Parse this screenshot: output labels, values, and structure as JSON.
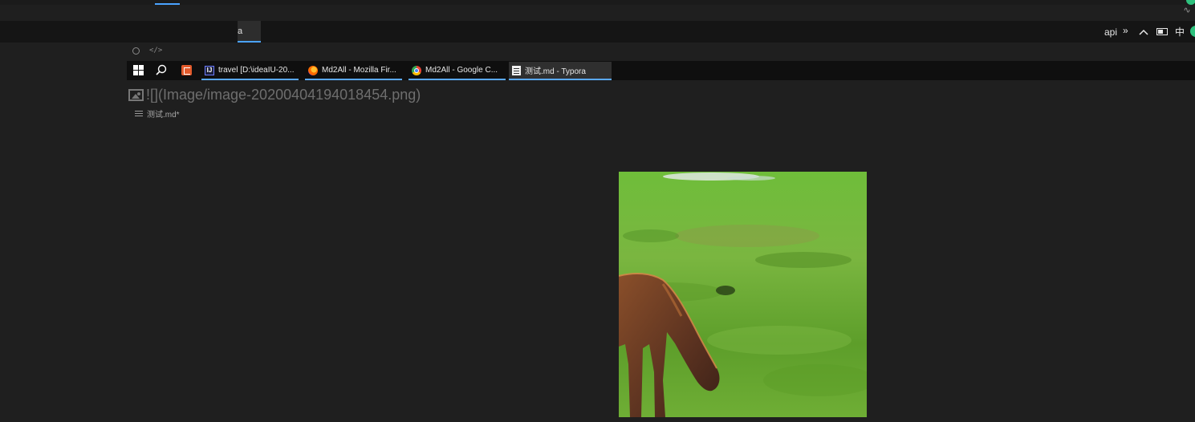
{
  "top_bar": {
    "right_glyph": "∿"
  },
  "tab_bar": {
    "active_tab_label": "a"
  },
  "tray": {
    "api_label": "api",
    "overflow_glyph": "»",
    "show_hidden_glyph": "^",
    "ime_label": "中"
  },
  "editor_toolbar": {
    "code_glyph": "</>"
  },
  "taskbar": {
    "items": [
      {
        "label": "travel [D:\\ideaIU-20...",
        "icon": "intellij-idea-icon",
        "icon_text": "IJ"
      },
      {
        "label": "Md2All - Mozilla Fir...",
        "icon": "firefox-icon"
      },
      {
        "label": "Md2All - Google C...",
        "icon": "chrome-icon"
      },
      {
        "label": "测试.md - Typora",
        "icon": "typora-icon",
        "active": true
      }
    ]
  },
  "editor": {
    "markdown_source": "![](Image/image-20200404194018454.png)",
    "file_name": "测试.md*"
  },
  "colors": {
    "background": "#1f1f1f",
    "accent": "#4aa3ff",
    "tray_green": "#2ec27e"
  }
}
